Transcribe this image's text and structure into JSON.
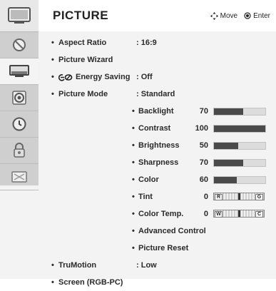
{
  "header": {
    "title": "PICTURE",
    "move_label": "Move",
    "enter_label": "Enter"
  },
  "sidebar": {
    "items": [
      {
        "icon": "tv-icon",
        "active": false
      },
      {
        "icon": "satellite-dish-icon",
        "active": false
      },
      {
        "icon": "picture-icon",
        "active": true
      },
      {
        "icon": "audio-icon",
        "active": false
      },
      {
        "icon": "clock-icon",
        "active": false
      },
      {
        "icon": "lock-icon",
        "active": false
      },
      {
        "icon": "option-icon",
        "active": false
      }
    ]
  },
  "menu": {
    "aspect_ratio": {
      "label": "Aspect Ratio",
      "value": ": 16:9"
    },
    "picture_wizard": {
      "label": "Picture Wizard"
    },
    "energy_saving": {
      "label": "Energy Saving",
      "value": ": Off"
    },
    "picture_mode": {
      "label": "Picture Mode",
      "value": ": Standard"
    },
    "sub": {
      "backlight": {
        "label": "Backlight",
        "value": "70",
        "level": 0.57
      },
      "contrast": {
        "label": "Contrast",
        "value": "100",
        "level": 1.0
      },
      "brightness": {
        "label": "Brightness",
        "value": "50",
        "level": 0.47
      },
      "sharpness": {
        "label": "Sharpness",
        "value": "70",
        "level": 0.57
      },
      "color": {
        "label": "Color",
        "value": "60",
        "level": 0.45
      },
      "tint": {
        "label": "Tint",
        "value": "0",
        "left": "R",
        "right": "G"
      },
      "color_temp": {
        "label": "Color Temp.",
        "value": "0",
        "left": "W",
        "right": "C"
      },
      "advanced_control": {
        "label": "Advanced Control"
      },
      "picture_reset": {
        "label": "Picture Reset"
      }
    },
    "trumotion": {
      "label": "TruMotion",
      "value": ": Low"
    },
    "screen": {
      "label": "Screen (RGB-PC)"
    }
  },
  "bullet": "•"
}
